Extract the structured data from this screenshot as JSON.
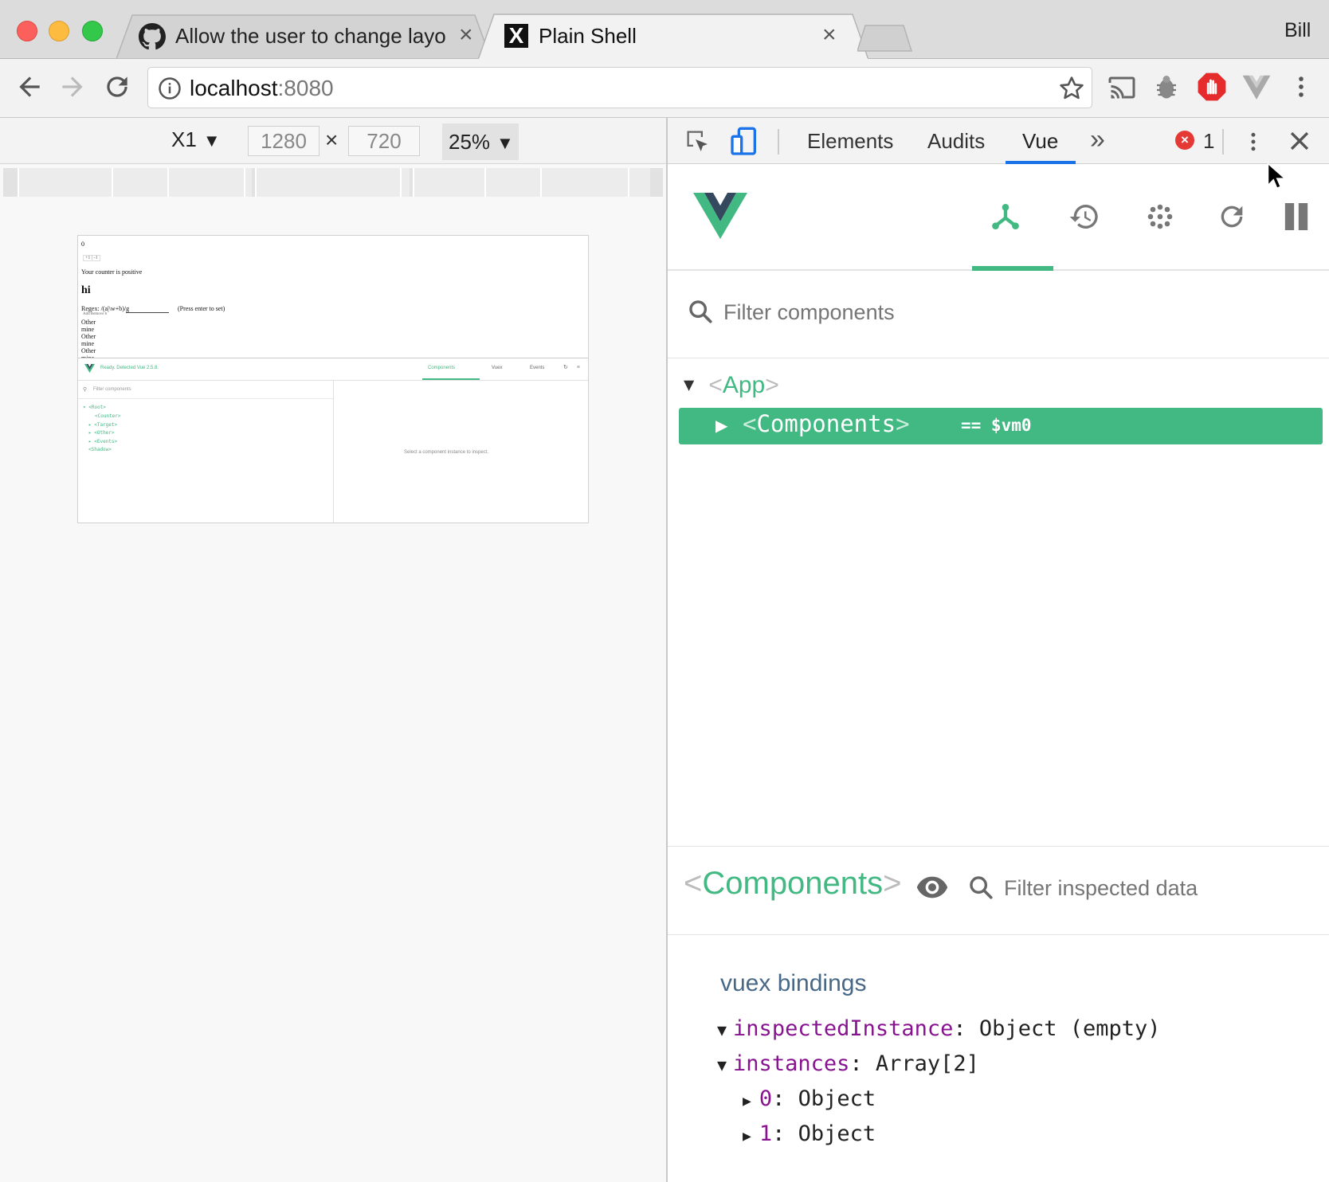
{
  "browser": {
    "user": "Bill",
    "tabs": [
      {
        "title": "Allow the user to change layou",
        "close": "×"
      },
      {
        "title": "Plain Shell",
        "close": "×"
      }
    ],
    "url_host": "localhost",
    "url_port": ":8080"
  },
  "device_toolbar": {
    "device": "X1",
    "width": "1280",
    "times": "×",
    "height": "720",
    "zoom": "25%"
  },
  "mini_page": {
    "counter": "0",
    "buttons": "+1 | -1",
    "counter_text": "Your counter is positive",
    "heading": "hi",
    "regex_label": "Regex: /(a|\\w+b)/g",
    "regex_hint": "(Press enter to set)",
    "add_remove": "Add   Remove   h",
    "list": [
      "Other",
      "mine",
      "Other",
      "mine",
      "Other",
      "mine"
    ],
    "ready": "Ready. Detected Vue 2.5.8.",
    "tabs": [
      "Components",
      "Vuex",
      "Events"
    ],
    "filter": "Filter components",
    "tree": [
      "<Root>",
      "<Counter>",
      "<Target>",
      "<Other>",
      "<Events>",
      "<Shadow>"
    ],
    "inspect_hint": "Select a component instance to inspect."
  },
  "devtools": {
    "tabs": {
      "elements": "Elements",
      "audits": "Audits",
      "vue": "Vue",
      "more": "»"
    },
    "error_count": "1",
    "accent": "#42b983"
  },
  "vue": {
    "filter_placeholder": "Filter components",
    "tree": {
      "app_open": "<",
      "app_name": "App",
      "app_close": ">",
      "selected_open": "<",
      "selected_name": "Components",
      "selected_close": ">",
      "selected_ref": "== $vm0"
    },
    "inspector": {
      "open": "<",
      "name": "Components",
      "close": ">",
      "filter_placeholder": "Filter inspected data",
      "section": "vuex bindings",
      "rows": [
        {
          "key": "inspectedInstance",
          "sep": ":",
          "value": "Object (empty)"
        },
        {
          "key": "instances",
          "sep": ":",
          "value": "Array[2]"
        },
        {
          "key": "0",
          "sep": ":",
          "value": "Object"
        },
        {
          "key": "1",
          "sep": ":",
          "value": "Object"
        }
      ]
    }
  }
}
